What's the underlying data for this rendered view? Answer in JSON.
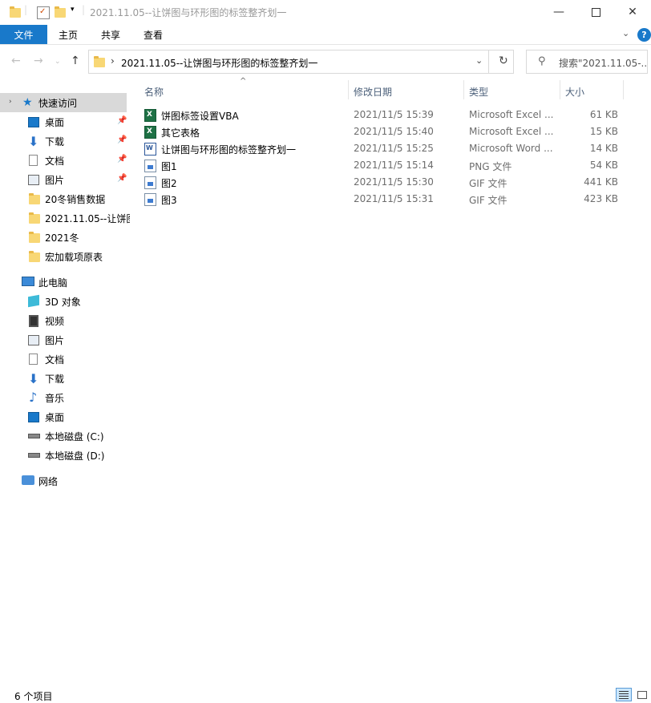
{
  "window": {
    "title": "2021.11.05--让饼图与环形图的标签整齐划一",
    "minimize_icon": "minimize-icon",
    "maximize_icon": "maximize-icon",
    "close_icon": "close-icon"
  },
  "ribbon": {
    "tabs": [
      "文件",
      "主页",
      "共享",
      "查看"
    ],
    "accent_color": "#1979ca"
  },
  "navigation": {
    "back_icon": "back-arrow-icon",
    "forward_icon": "forward-arrow-icon",
    "recent_icon": "chevron-down-icon",
    "up_icon": "up-arrow-icon",
    "address": "2021.11.05--让饼图与环形图的标签整齐划一",
    "search_placeholder": "搜索\"2021.11.05-..."
  },
  "sidebar": {
    "quick_access": {
      "label": "快速访问",
      "items": [
        {
          "label": "桌面",
          "pinned": true
        },
        {
          "label": "下载",
          "pinned": true
        },
        {
          "label": "文档",
          "pinned": true
        },
        {
          "label": "图片",
          "pinned": true
        },
        {
          "label": "20冬销售数据",
          "pinned": false
        },
        {
          "label": "2021.11.05--让饼图",
          "pinned": false
        },
        {
          "label": "2021冬",
          "pinned": false
        },
        {
          "label": "宏加载项原表",
          "pinned": false
        }
      ]
    },
    "this_pc": {
      "label": "此电脑",
      "items": [
        "3D 对象",
        "视频",
        "图片",
        "文档",
        "下载",
        "音乐",
        "桌面",
        "本地磁盘 (C:)",
        "本地磁盘 (D:)"
      ]
    },
    "network": {
      "label": "网络"
    }
  },
  "columns": {
    "name": "名称",
    "date": "修改日期",
    "type": "类型",
    "size": "大小"
  },
  "files": [
    {
      "name": "饼图标签设置VBA",
      "date": "2021/11/5 15:39",
      "type": "Microsoft Excel ...",
      "size": "61 KB",
      "icon": "excel-file-icon"
    },
    {
      "name": "其它表格",
      "date": "2021/11/5 15:40",
      "type": "Microsoft Excel ...",
      "size": "15 KB",
      "icon": "excel-file-icon"
    },
    {
      "name": "让饼图与环形图的标签整齐划一",
      "date": "2021/11/5 15:25",
      "type": "Microsoft Word ...",
      "size": "14 KB",
      "icon": "word-file-icon"
    },
    {
      "name": "图1",
      "date": "2021/11/5 15:14",
      "type": "PNG 文件",
      "size": "54 KB",
      "icon": "image-file-icon"
    },
    {
      "name": "图2",
      "date": "2021/11/5 15:30",
      "type": "GIF 文件",
      "size": "441 KB",
      "icon": "image-file-icon"
    },
    {
      "name": "图3",
      "date": "2021/11/5 15:31",
      "type": "GIF 文件",
      "size": "423 KB",
      "icon": "image-file-icon"
    }
  ],
  "status": {
    "item_count": "6 个项目"
  }
}
